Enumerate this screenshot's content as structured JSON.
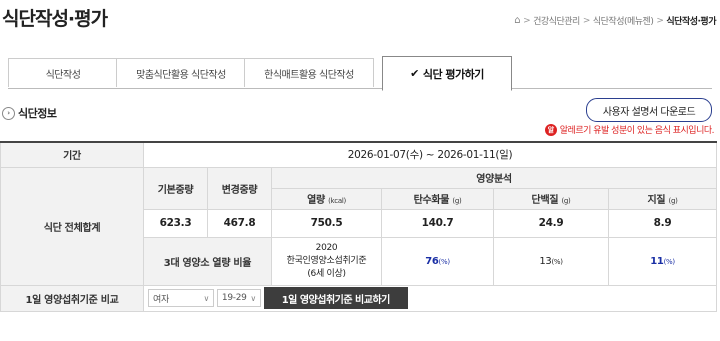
{
  "header": {
    "title": "식단작성·평가",
    "breadcrumb": [
      "건강식단관리",
      "식단작성(메뉴젠)",
      "식단작성·평가"
    ]
  },
  "tabs": [
    {
      "label": "식단작성",
      "active": false
    },
    {
      "label": "맞춤식단활용 식단작성",
      "active": false
    },
    {
      "label": "한식매트활용 식단작성",
      "active": false
    },
    {
      "label": "식단 평가하기",
      "active": true
    }
  ],
  "section": {
    "title": "식단정보",
    "manual_button": "사용자 설명서 다운로드",
    "allergy_icon": "알",
    "allergy_note": "알레르기 유발 성분이 있는 음식 표시입니다."
  },
  "table": {
    "period_label": "기간",
    "period_value": "2026-01-07(수) ~ 2026-01-11(일)",
    "total_label": "식단 전체합계",
    "base_weight_label": "기본중량",
    "changed_weight_label": "변경중량",
    "nutrition_label": "영양분석",
    "columns": [
      {
        "name": "열량",
        "unit": "(kcal)"
      },
      {
        "name": "탄수화물",
        "unit": "(g)"
      },
      {
        "name": "단백질",
        "unit": "(g)"
      },
      {
        "name": "지질",
        "unit": "(g)"
      }
    ],
    "values": {
      "base_weight": "623.3",
      "changed_weight": "467.8",
      "energy": "750.5",
      "carb": "140.7",
      "protein": "24.9",
      "fat": "8.9"
    },
    "ratio_label": "3대 영양소 열량 비율",
    "standard": {
      "line1": "2020",
      "line2": "한국인영양소섭취기준",
      "line3": "(6세 이상)"
    },
    "ratios": {
      "carb": "76",
      "protein": "13",
      "fat": "11",
      "unit": "(%)"
    },
    "ratio_colors": {
      "carb": "#1a2fa5",
      "protein": "#222222",
      "fat": "#1a2fa5"
    },
    "compare_label": "1일 영양섭취기준 비교",
    "gender_select": "여자",
    "age_select": "19-29",
    "compare_button": "1일 영양섭취기준 비교하기"
  },
  "colors": {
    "accent": "#2b3f8f",
    "allergy": "#dd2222",
    "ratio_blue": "#1a2fa5"
  }
}
